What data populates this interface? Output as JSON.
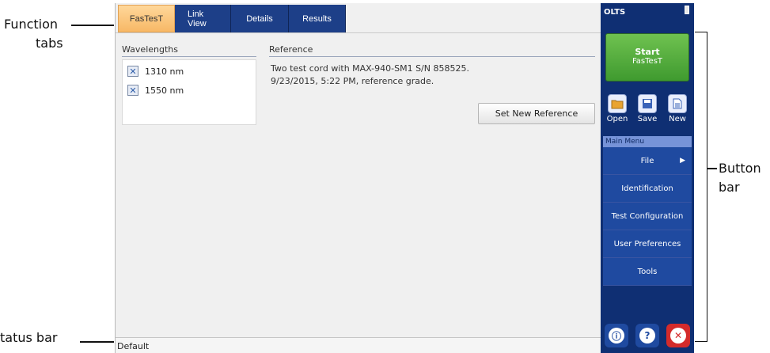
{
  "callouts": {
    "function_tabs_1": "Function",
    "function_tabs_2": "tabs",
    "status_bar": "tatus bar",
    "button_bar_1": "Button",
    "button_bar_2": "bar"
  },
  "tabs": [
    {
      "label": "FasTesT",
      "active": true
    },
    {
      "label": "Link View",
      "active": false
    },
    {
      "label": "Details",
      "active": false
    },
    {
      "label": "Results",
      "active": false
    }
  ],
  "wavelengths": {
    "label": "Wavelengths",
    "items": [
      "1310 nm",
      "1550 nm"
    ]
  },
  "reference": {
    "label": "Reference",
    "line1": "Two test cord with MAX-940-SM1 S/N 858525.",
    "line2": "9/23/2015, 5:22 PM, reference grade.",
    "set_button": "Set New Reference"
  },
  "status": {
    "text": "Default"
  },
  "sidebar": {
    "title": "OLTS",
    "start_label": "Start",
    "start_sub": "FasTesT",
    "tools": [
      {
        "label": "Open",
        "icon": "folder-icon"
      },
      {
        "label": "Save",
        "icon": "floppy-icon"
      },
      {
        "label": "New",
        "icon": "new-doc-icon"
      }
    ],
    "menu_header": "Main Menu",
    "menu": [
      "File",
      "Identification",
      "Test Configuration",
      "User Preferences",
      "Tools"
    ],
    "bottom_icons": [
      "info-icon",
      "help-icon",
      "close-icon"
    ]
  }
}
